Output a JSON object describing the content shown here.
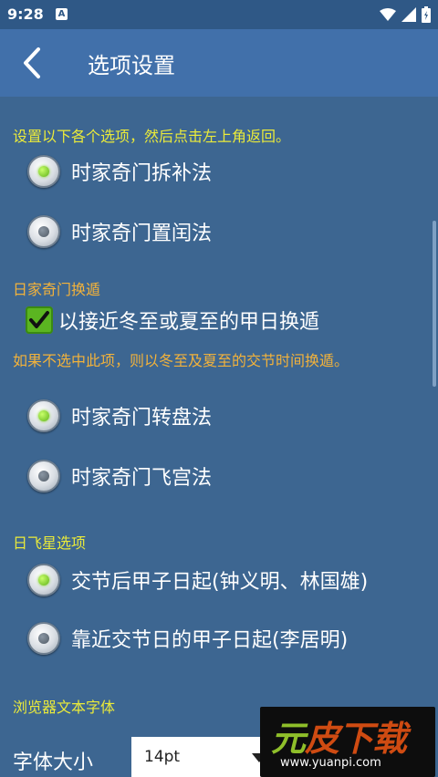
{
  "status_bar": {
    "time": "9:28",
    "notif_badge": "A"
  },
  "app_bar": {
    "title": "选项设置"
  },
  "instruction": "设置以下各个选项，然后点击左上角返回。",
  "group1": {
    "options": [
      {
        "label": "时家奇门拆补法",
        "selected": true
      },
      {
        "label": "时家奇门置闰法",
        "selected": false
      }
    ]
  },
  "group2": {
    "heading": "日家奇门换遁",
    "checkbox_label": "以接近冬至或夏至的甲日换遁",
    "checked": true,
    "note": "如果不选中此项，则以冬至及夏至的交节时间换遁。"
  },
  "group3": {
    "options": [
      {
        "label": "时家奇门转盘法",
        "selected": true
      },
      {
        "label": "时家奇门飞宫法",
        "selected": false
      }
    ]
  },
  "group4": {
    "heading": "日飞星选项",
    "options": [
      {
        "label": "交节后甲子日起(钟义明、林国雄)",
        "selected": true
      },
      {
        "label": "靠近交节日的甲子日起(李居明)",
        "selected": false
      }
    ]
  },
  "group5": {
    "heading": "浏览器文本字体",
    "font_size_label": "字体大小",
    "font_size_value": "14pt"
  },
  "watermark": {
    "part1": "元",
    "part2": "皮下载",
    "url": "www.yuanpi.com"
  },
  "colors": {
    "background": "#3d6691",
    "app_bar": "#4170aa",
    "heading_yellow": "#eaea3a",
    "note_orange": "#f2b23b",
    "selected_dot": "#7fd31f"
  }
}
